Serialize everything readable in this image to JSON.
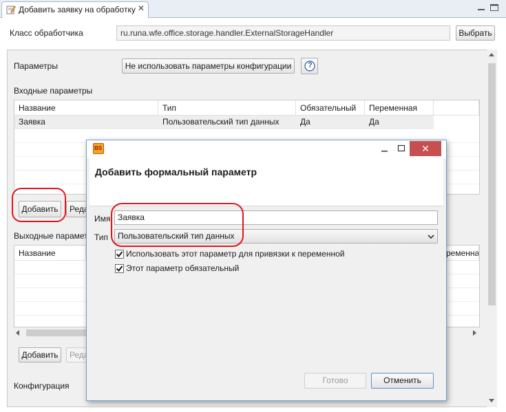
{
  "editor_tab": {
    "title": "Добавить заявку на обработку",
    "icon": "edit-document-icon",
    "close_glyph": "✕"
  },
  "handler": {
    "label": "Класс обработчика",
    "value": "ru.runa.wfe.office.storage.handler.ExternalStorageHandler",
    "choose_button": "Выбрать"
  },
  "parameters": {
    "label": "Параметры",
    "config_button": "Не использовать параметры конфигурации",
    "help_glyph": "?"
  },
  "input_params": {
    "section_label": "Входные параметры",
    "columns": [
      "Название",
      "Тип",
      "Обязательный",
      "Переменная"
    ],
    "rows": [
      [
        "Заявка",
        "Пользовательский тип данных",
        "Да",
        "Да"
      ]
    ],
    "add_button": "Добавить",
    "edit_button_partial": "Реда"
  },
  "output_params": {
    "section_label": "Выходные парамет",
    "columns": [
      "Название"
    ],
    "col_partial": "ременная",
    "add_button": "Добавить",
    "edit_button_partial": "Реда"
  },
  "configuration": {
    "label": "Конфигурация"
  },
  "dialog": {
    "app_icon_text": "BS",
    "title": "Добавить формальный параметр",
    "name_label": "Имя",
    "name_value": "Заявка",
    "type_label": "Тип",
    "type_value": "Пользовательский тип данных",
    "use_for_binding_label": "Использовать этот параметр для привязки к переменной",
    "use_for_binding_checked": true,
    "required_label": "Этот параметр обязательный",
    "required_checked": true,
    "ok_button": "Готово",
    "cancel_button": "Отменить",
    "close_glyph": "✕"
  },
  "colors": {
    "highlight_circle": "#e0161b",
    "dialog_border": "#6d9fcf",
    "close_button": "#c74f4f"
  }
}
